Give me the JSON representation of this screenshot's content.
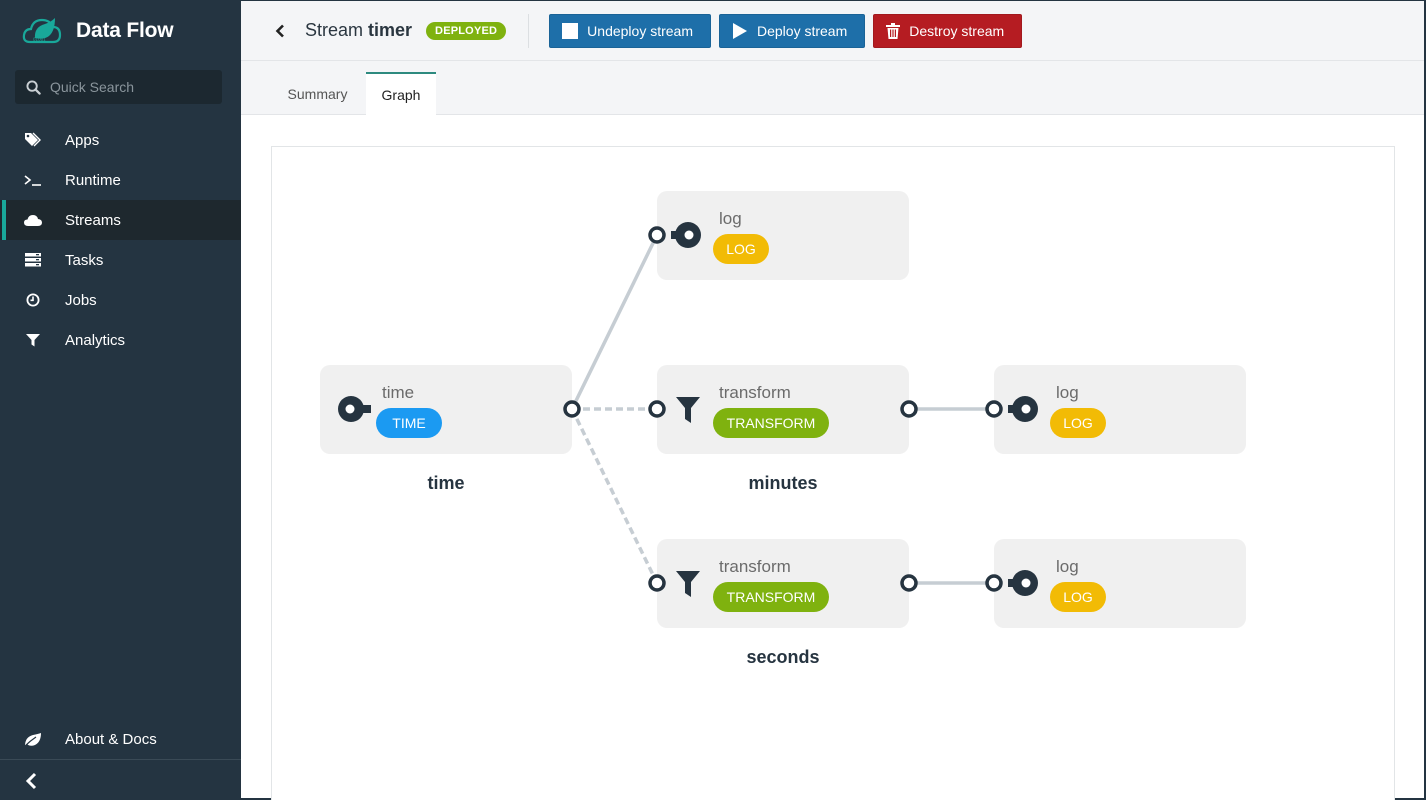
{
  "app": {
    "title": "Data Flow",
    "logo_icon": "spring-cloud-dataflow-logo"
  },
  "search": {
    "placeholder": "Quick Search",
    "value": ""
  },
  "sidebar": {
    "items": [
      {
        "label": "Apps",
        "icon": "tags-icon",
        "active": false
      },
      {
        "label": "Runtime",
        "icon": "terminal-icon",
        "active": false
      },
      {
        "label": "Streams",
        "icon": "cloud-icon",
        "active": true
      },
      {
        "label": "Tasks",
        "icon": "server-icon",
        "active": false
      },
      {
        "label": "Jobs",
        "icon": "clock-icon",
        "active": false
      },
      {
        "label": "Analytics",
        "icon": "filter-icon",
        "active": false
      }
    ],
    "about_label": "About & Docs",
    "collapse_icon": "chevron-left-icon"
  },
  "header": {
    "title_prefix": "Stream ",
    "title_name": "timer",
    "status": "DEPLOYED",
    "buttons": {
      "undeploy": "Undeploy stream",
      "deploy": "Deploy stream",
      "destroy": "Destroy stream"
    }
  },
  "tabs": [
    {
      "label": "Summary",
      "active": false
    },
    {
      "label": "Graph",
      "active": true
    }
  ],
  "graph": {
    "colors": {
      "time": "#1b9af2",
      "transform": "#7fb20f",
      "log": "#f2bb05",
      "node_bg": "#f0f0f0",
      "port": "#263440",
      "link": "#c6cdd3"
    },
    "nodes": [
      {
        "id": "time",
        "title": "time",
        "type": "TIME",
        "kind": "source",
        "label": "time"
      },
      {
        "id": "log-tap",
        "title": "log",
        "type": "LOG",
        "kind": "sink",
        "label": ""
      },
      {
        "id": "minutes",
        "title": "transform",
        "type": "TRANSFORM",
        "kind": "processor",
        "label": "minutes"
      },
      {
        "id": "log-minutes",
        "title": "log",
        "type": "LOG",
        "kind": "sink",
        "label": ""
      },
      {
        "id": "seconds",
        "title": "transform",
        "type": "TRANSFORM",
        "kind": "processor",
        "label": "seconds"
      },
      {
        "id": "log-seconds",
        "title": "log",
        "type": "LOG",
        "kind": "sink",
        "label": ""
      }
    ],
    "links": [
      {
        "from": "time",
        "to": "log-tap",
        "style": "solid"
      },
      {
        "from": "time",
        "to": "minutes",
        "style": "dashed"
      },
      {
        "from": "time",
        "to": "seconds",
        "style": "dashed"
      },
      {
        "from": "minutes",
        "to": "log-minutes",
        "style": "solid"
      },
      {
        "from": "seconds",
        "to": "log-seconds",
        "style": "solid"
      }
    ]
  }
}
